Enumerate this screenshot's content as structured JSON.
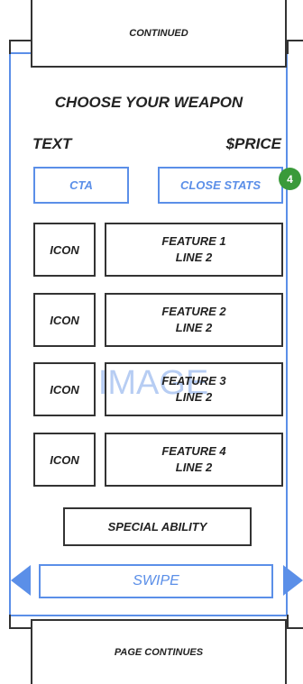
{
  "header": {
    "label": "CONTINUED"
  },
  "title": "CHOOSE YOUR WEAPON",
  "info": {
    "text": "TEXT",
    "price": "$PRICE"
  },
  "buttons": {
    "cta": "CTA",
    "close_stats": "CLOSE STATS",
    "badge": "4"
  },
  "image_label": "IMAGE",
  "features": [
    {
      "icon": "ICON",
      "text": "FEATURE 1\nLINE 2"
    },
    {
      "icon": "ICON",
      "text": "FEATURE 2\nLINE 2"
    },
    {
      "icon": "ICON",
      "text": "FEATURE 3\nLINE 2"
    },
    {
      "icon": "ICON",
      "text": "FEATURE 4\nLINE 2"
    }
  ],
  "special_ability": "SPECIAL ABILITY",
  "swipe": "SWIPE",
  "footer": {
    "label": "PAGE CONTINUES"
  },
  "colors": {
    "accent": "#5b8fe8",
    "badge": "#3a9a3a",
    "outline": "#333333"
  }
}
